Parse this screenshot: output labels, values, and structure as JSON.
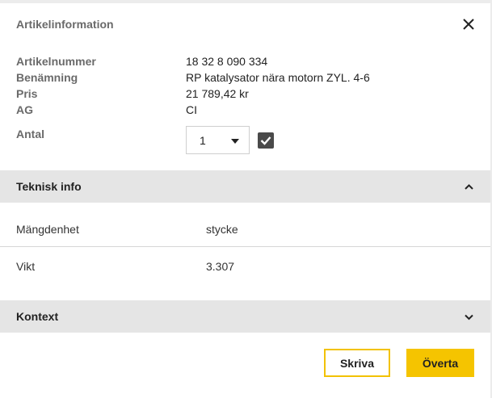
{
  "header": {
    "title": "Artikelinformation"
  },
  "article": {
    "number_label": "Artikelnummer",
    "number_value": "18 32 8 090 334",
    "name_label": "Benämning",
    "name_value": "RP katalysator nära motorn ZYL. 4-6",
    "price_label": "Pris",
    "price_value": "21 789,42 kr",
    "ag_label": "AG",
    "ag_value": "CI",
    "quantity_label": "Antal",
    "quantity_value": "1",
    "confirm_checked": true
  },
  "technical": {
    "title": "Teknisk info",
    "expanded": true,
    "rows": [
      {
        "label": "Mängdenhet",
        "value": "stycke"
      },
      {
        "label": "Vikt",
        "value": "3.307"
      }
    ]
  },
  "context": {
    "title": "Kontext",
    "expanded": false
  },
  "footer": {
    "print_label": "Skriva",
    "transfer_label": "Överta"
  },
  "colors": {
    "accent": "#f5c400",
    "section_bg": "#e5e5e5",
    "checkbox": "#4a4a4a"
  },
  "icons": {
    "close": "close-icon",
    "check": "check-icon",
    "expand": "chevron-up-icon",
    "collapse": "chevron-down-icon",
    "dropdown": "caret-down-icon"
  }
}
